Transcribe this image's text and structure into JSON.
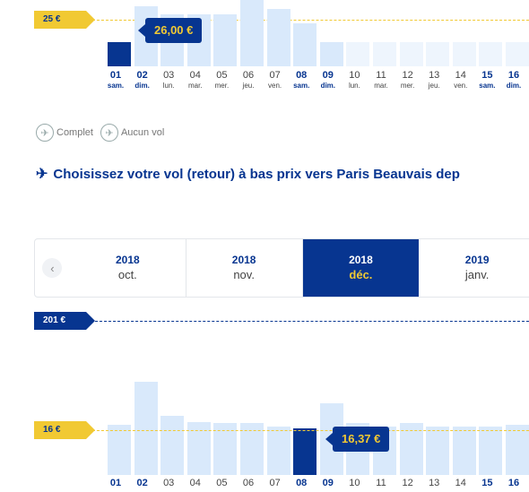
{
  "top_chart": {
    "max_tag": "25 €",
    "tooltip": "26,00 €",
    "selected_index": 0,
    "values": [
      22.4,
      26.0,
      25.2,
      25.2,
      25.2,
      26.8,
      25.7,
      24.3,
      22.4,
      22.4,
      22.4,
      22.4,
      22.4,
      22.4,
      22.4,
      22.4
    ],
    "days": [
      {
        "n": "01",
        "w": "sam.",
        "we": true
      },
      {
        "n": "02",
        "w": "dim.",
        "we": true
      },
      {
        "n": "03",
        "w": "lun.",
        "we": false
      },
      {
        "n": "04",
        "w": "mar.",
        "we": false
      },
      {
        "n": "05",
        "w": "mer.",
        "we": false
      },
      {
        "n": "06",
        "w": "jeu.",
        "we": false
      },
      {
        "n": "07",
        "w": "ven.",
        "we": false
      },
      {
        "n": "08",
        "w": "sam.",
        "we": true
      },
      {
        "n": "09",
        "w": "dim.",
        "we": true
      },
      {
        "n": "10",
        "w": "lun.",
        "we": false
      },
      {
        "n": "11",
        "w": "mar.",
        "we": false
      },
      {
        "n": "12",
        "w": "mer.",
        "we": false
      },
      {
        "n": "13",
        "w": "jeu.",
        "we": false
      },
      {
        "n": "14",
        "w": "ven.",
        "we": false
      },
      {
        "n": "15",
        "w": "sam.",
        "we": true
      },
      {
        "n": "16",
        "w": "dim.",
        "we": true
      }
    ]
  },
  "legend": {
    "complete_label": "Complet",
    "no_flight_label": "Aucun vol"
  },
  "heading": "Choisissez votre vol (retour) à bas prix vers Paris Beauvais dep",
  "months": [
    {
      "year": "2018",
      "month": "oct."
    },
    {
      "year": "2018",
      "month": "nov."
    },
    {
      "year": "2018",
      "month": "déc."
    },
    {
      "year": "2019",
      "month": "janv."
    }
  ],
  "active_month_index": 2,
  "bottom_chart": {
    "max_tag": "201 €",
    "min_tag": "16 €",
    "tooltip": "16,37 €",
    "selected_index": 7,
    "days": [
      "01",
      "02",
      "03",
      "04",
      "05",
      "06",
      "07",
      "08",
      "09",
      "10",
      "11",
      "12",
      "13",
      "14",
      "15",
      "16"
    ],
    "bold_days": [
      0,
      1,
      7,
      8,
      14,
      15
    ]
  },
  "colors": {
    "navy": "#073590",
    "yellow": "#f1c933",
    "bar_light": "#d9e9fb",
    "bar_faint": "#eef5fd"
  }
}
